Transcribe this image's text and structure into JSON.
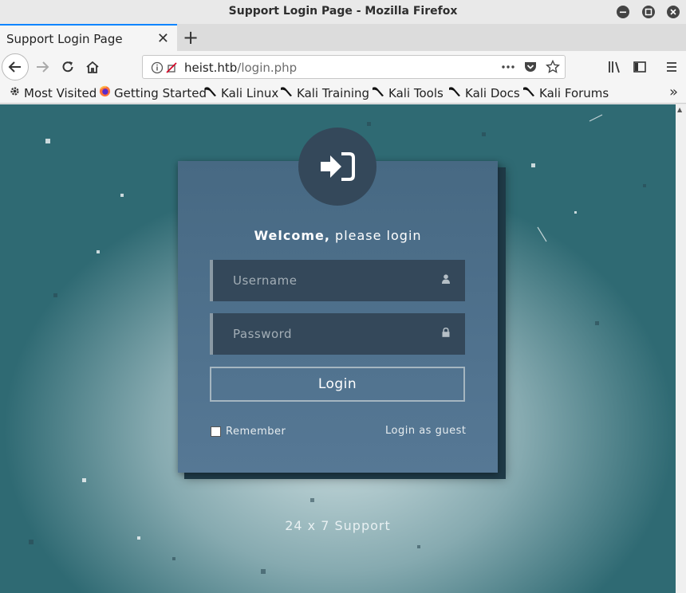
{
  "window": {
    "title": "Support Login Page - Mozilla Firefox"
  },
  "tabs": [
    {
      "label": "Support Login Page",
      "active": true
    }
  ],
  "nav": {
    "url_host": "heist.htb",
    "url_path": "/login.php"
  },
  "bookmarks": [
    {
      "label": "Most Visited",
      "icon": "gear-icon"
    },
    {
      "label": "Getting Started",
      "icon": "firefox-icon"
    },
    {
      "label": "Kali Linux",
      "icon": "kali-dragon-icon"
    },
    {
      "label": "Kali Training",
      "icon": "kali-dragon-icon"
    },
    {
      "label": "Kali Tools",
      "icon": "kali-dragon-icon"
    },
    {
      "label": "Kali Docs",
      "icon": "kali-dragon-icon"
    },
    {
      "label": "Kali Forums",
      "icon": "kali-dragon-icon"
    }
  ],
  "login": {
    "welcome_bold": "Welcome,",
    "welcome_rest": " please login",
    "username_placeholder": "Username",
    "password_placeholder": "Password",
    "login_button": "Login",
    "remember_label": "Remember",
    "guest_link": "Login as guest",
    "footer": "24 x 7 Support"
  },
  "colors": {
    "card": "#4f7290",
    "field": "#34485a",
    "accent_tab": "#0a84ff"
  }
}
